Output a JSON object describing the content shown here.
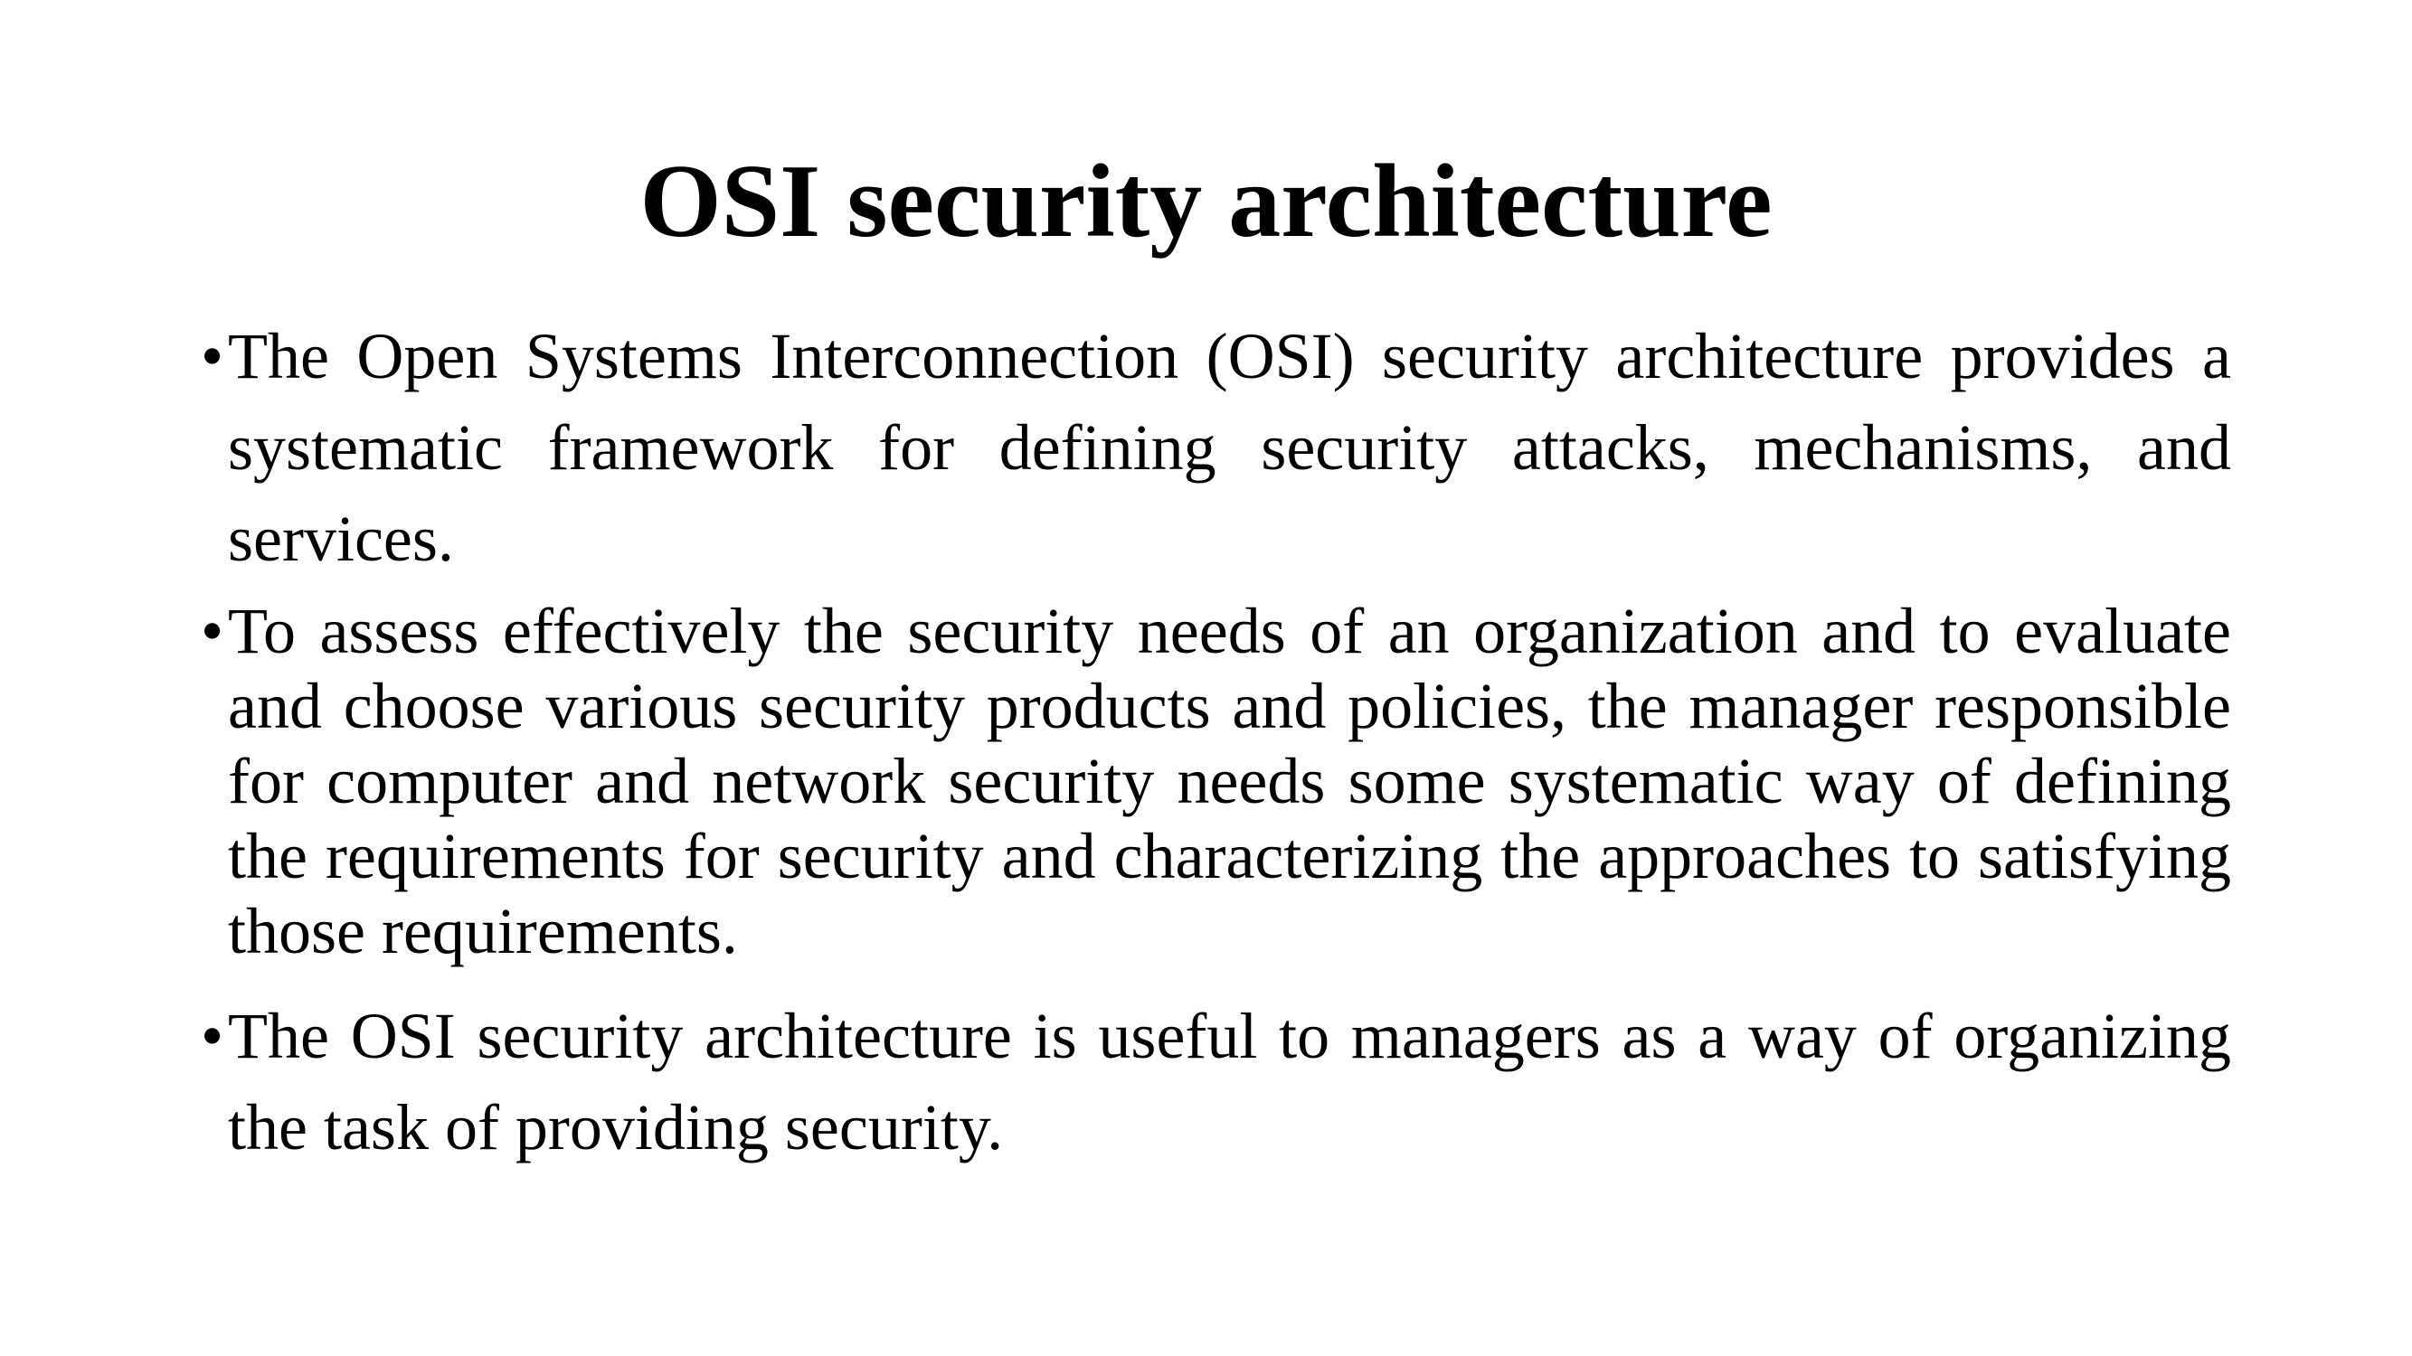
{
  "slide": {
    "title": "OSI security architecture",
    "bullet_symbol": "•",
    "bullets": [
      "The Open Systems Interconnection (OSI) security architecture provides a systematic framework for defining security attacks, mechanisms, and services.",
      "To assess effectively the security needs of an organization and to evaluate and choose various security products and policies, the manager responsible for computer and network security needs some systematic way of defining the requirements for security and characterizing the approaches to satisfying those requirements.",
      "The OSI security architecture is useful to managers as a way of organizing the task of providing security."
    ]
  }
}
